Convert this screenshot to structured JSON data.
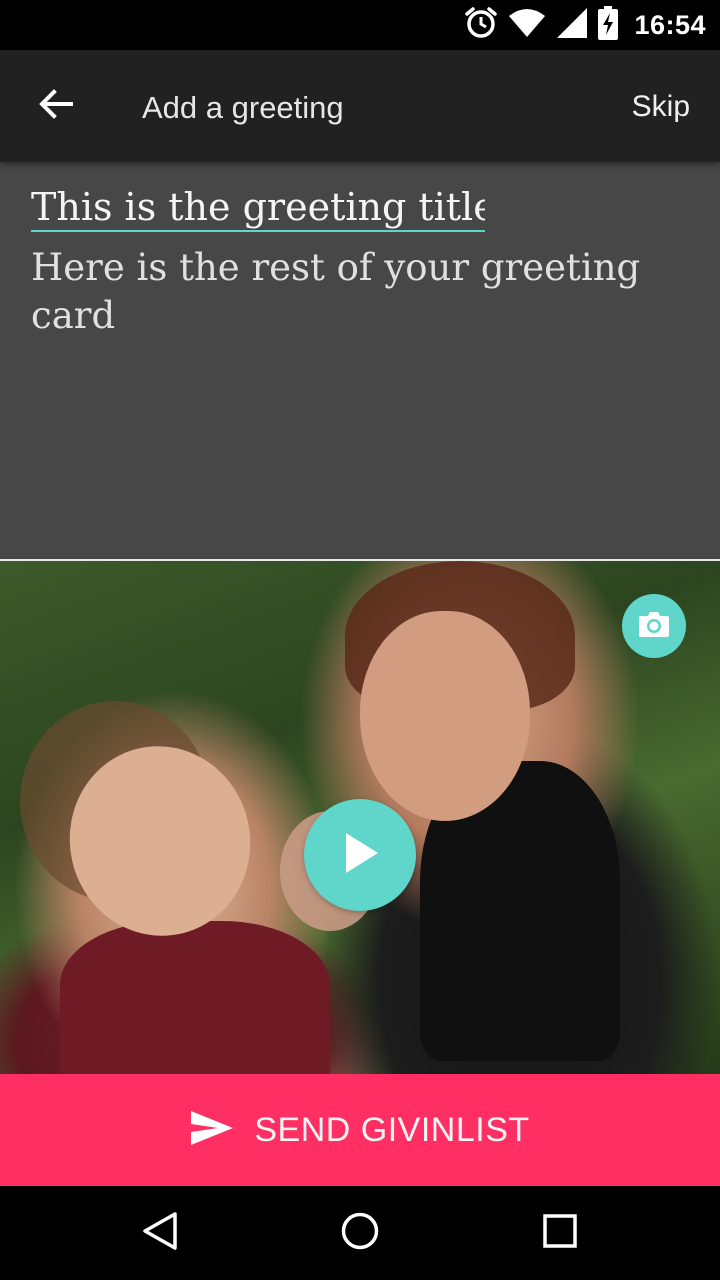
{
  "status_bar": {
    "time": "16:54",
    "icons": [
      "alarm-icon",
      "wifi-icon",
      "signal-icon",
      "battery-charging-icon"
    ]
  },
  "app_bar": {
    "title": "Add a greeting",
    "skip_label": "Skip",
    "back_icon": "arrow-back-icon"
  },
  "greeting": {
    "title_value": "This is the greeting title",
    "body_value": "Here is the rest of your greeting card"
  },
  "media": {
    "camera_icon": "camera-icon",
    "play_icon": "play-icon"
  },
  "send": {
    "label": "SEND GIVINLIST",
    "icon": "send-icon"
  },
  "nav_bar": {
    "items": [
      "back-triangle-icon",
      "home-circle-icon",
      "recents-square-icon"
    ]
  },
  "colors": {
    "accent": "#5fd6c9",
    "send_button": "#ff2e63",
    "app_bar": "#212121",
    "editor_bg": "#474747"
  }
}
